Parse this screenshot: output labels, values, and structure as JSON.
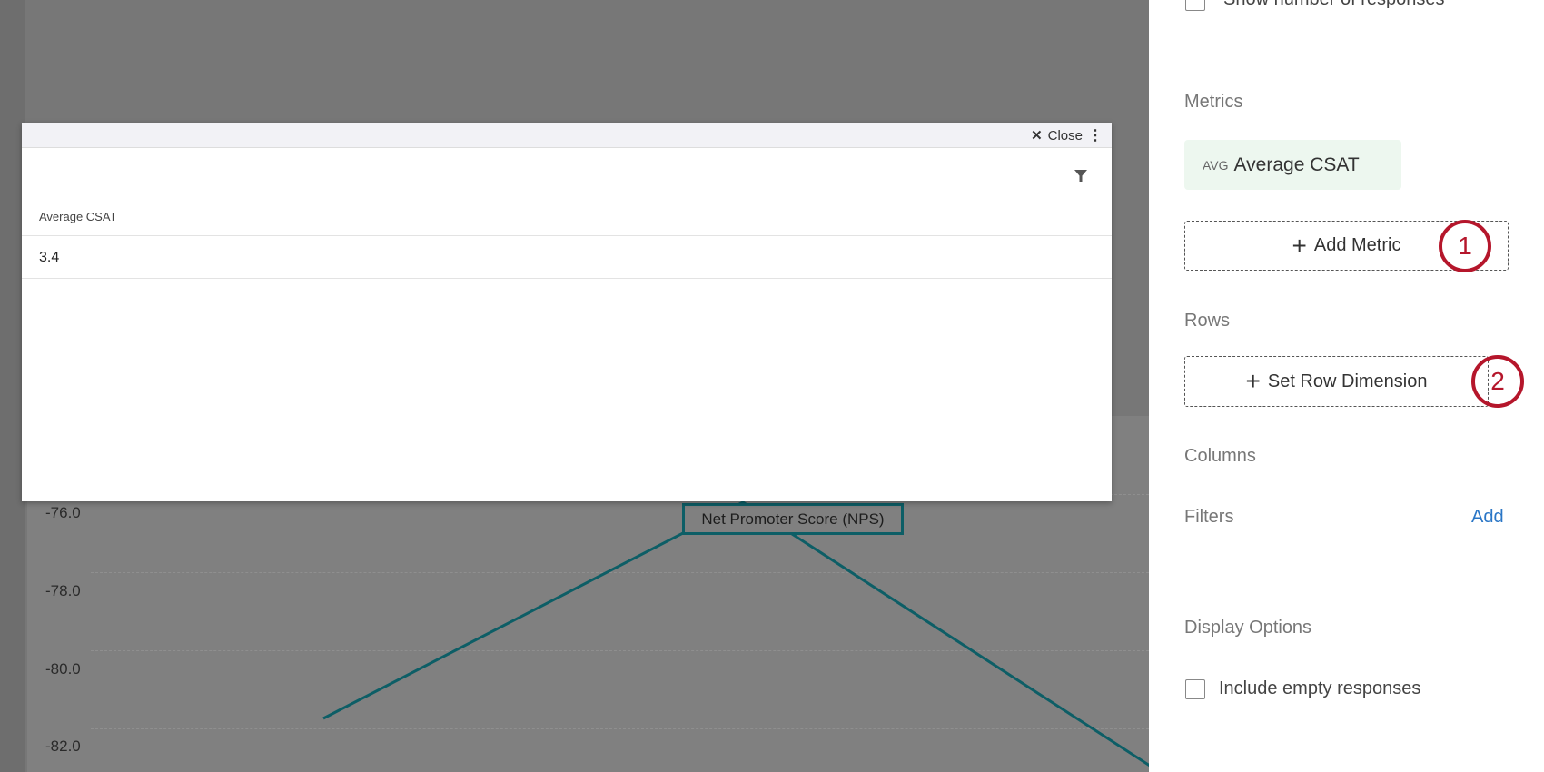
{
  "chart": {
    "y_ticks": [
      "-76.0",
      "-78.0",
      "-80.0",
      "-82.0"
    ],
    "series_label": "Net Promoter Score (NPS)",
    "line_color": "#0d5e66"
  },
  "modal": {
    "close_label": "Close",
    "column_header": "Average CSAT",
    "cell_value": "3.4"
  },
  "panel": {
    "show_responses_label": "Show number of responses",
    "metrics_label": "Metrics",
    "metric_chip": {
      "agg": "AVG",
      "name": "Average CSAT"
    },
    "add_metric_label": "Add Metric",
    "rows_label": "Rows",
    "set_row_label": "Set Row Dimension",
    "columns_label": "Columns",
    "filters_label": "Filters",
    "filters_add": "Add",
    "display_options_label": "Display Options",
    "include_empty_label": "Include empty responses",
    "callouts": [
      "1",
      "2"
    ],
    "callout_color": "#b5162b"
  }
}
